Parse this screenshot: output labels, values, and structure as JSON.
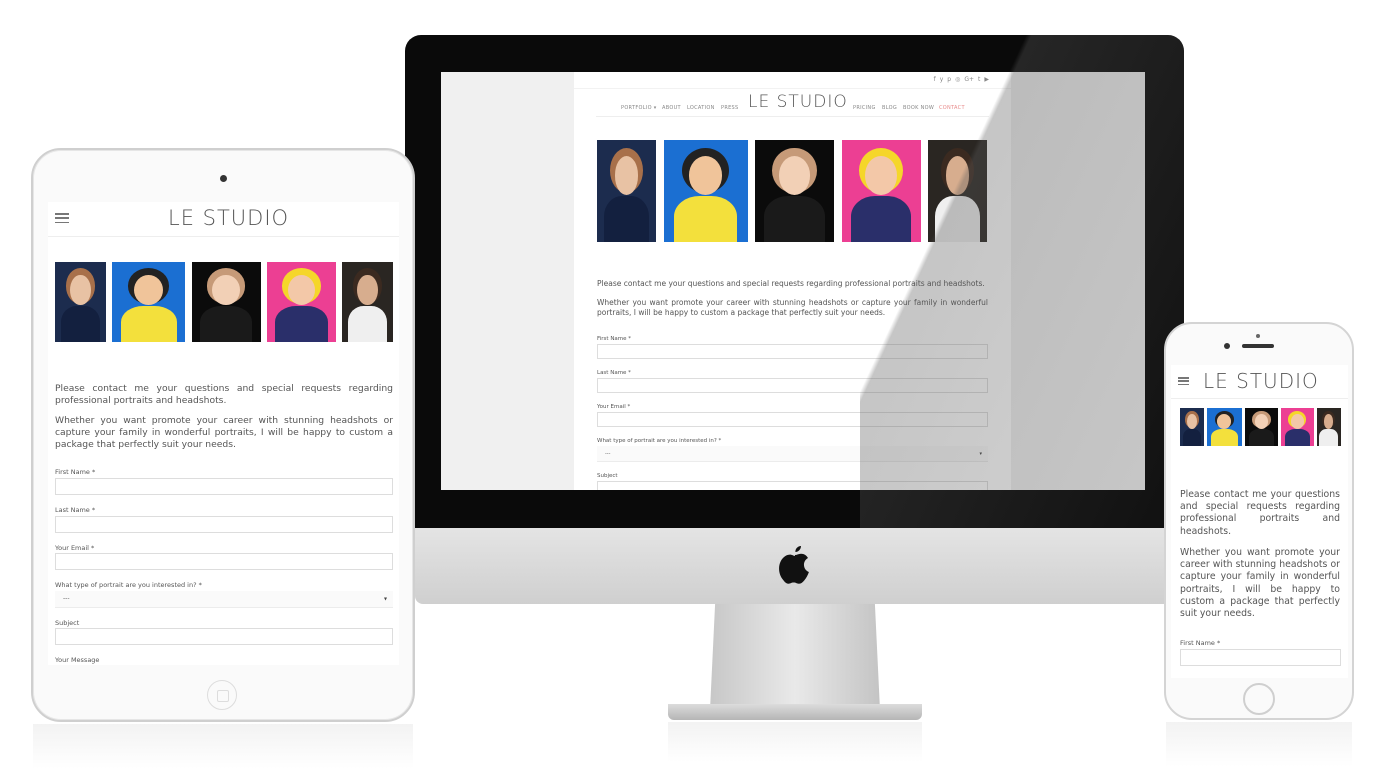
{
  "brand": {
    "logo": "LE STUDIO"
  },
  "desktop": {
    "social_icons": [
      "facebook-icon",
      "twitter-icon",
      "pinterest-icon",
      "instagram-icon",
      "google-plus-icon",
      "tumblr-icon",
      "youtube-icon"
    ],
    "social_glyphs": [
      "f",
      "y",
      "p",
      "◎",
      "G+",
      "t",
      "▶"
    ],
    "nav_left": [
      "PORTFOLIO ▾",
      "ABOUT",
      "LOCATION",
      "PRESS"
    ],
    "nav_right": [
      "PRICING",
      "BLOG",
      "BOOK NOW",
      "CONTACT"
    ],
    "active_nav": "CONTACT",
    "accent_color": "#e88b8b"
  },
  "content": {
    "intro": "Please contact me your questions and special requests regarding professional portraits and headshots.",
    "body": "Whether you want promote your career with stunning headshots or capture your family in wonderful portraits, I will be happy to custom a package that perfectly suit your needs."
  },
  "form": {
    "first_name": "First Name *",
    "last_name": "Last Name *",
    "email": "Your Email *",
    "portrait_type": "What type of portrait are you interested in? *",
    "portrait_type_value": "---",
    "subject": "Subject",
    "message": "Your Message",
    "caret": "▾"
  },
  "photos": [
    {
      "name": "woman-blonde",
      "bg": "#1c2c4e",
      "skin": "#e8c2a4",
      "hair": "#a8704a",
      "cloth": "#13203f"
    },
    {
      "name": "kids-blue",
      "bg": "#1b6fd2",
      "skin": "#f0c49a",
      "hair": "#222222",
      "cloth": "#f3e03c"
    },
    {
      "name": "baby-black",
      "bg": "#0b0b0b",
      "skin": "#f2d0b6",
      "hair": "#c69a78",
      "cloth": "#1a1a1a"
    },
    {
      "name": "girl-pink",
      "bg": "#ec3f93",
      "skin": "#f3c8a8",
      "hair": "#f5d62a",
      "cloth": "#2a2f6a"
    },
    {
      "name": "man-dark",
      "bg": "#2a2622",
      "skin": "#d7ad8e",
      "hair": "#3b2a20",
      "cloth": "#efefef"
    }
  ],
  "icons": {
    "menu": "hamburger-icon",
    "apple": "apple-logo-icon"
  }
}
